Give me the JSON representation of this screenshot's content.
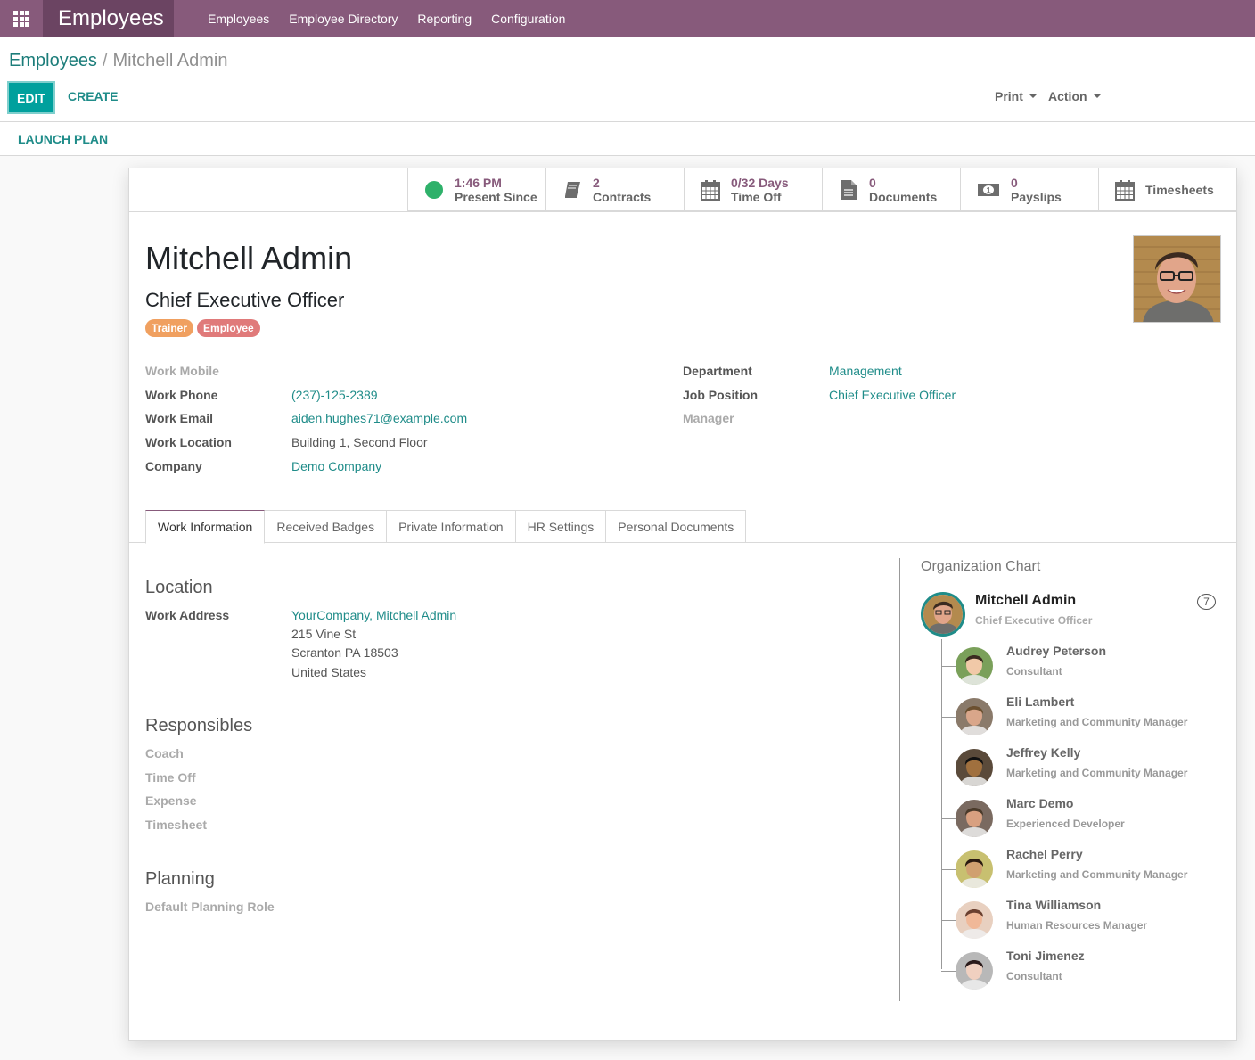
{
  "navbar": {
    "app_name": "Employees",
    "menu": [
      "Employees",
      "Employee Directory",
      "Reporting",
      "Configuration"
    ],
    "color": "#875a7b"
  },
  "breadcrumb": {
    "parent": "Employees",
    "separator": "/",
    "current": "Mitchell Admin"
  },
  "toolbar": {
    "edit_label": "EDIT",
    "create_label": "CREATE",
    "print_label": "Print",
    "action_label": "Action"
  },
  "statusbar": {
    "launch_plan_label": "LAUNCH PLAN"
  },
  "smart_buttons": [
    {
      "icon": "presence-dot-icon",
      "value": "1:46 PM",
      "label": "Present Since"
    },
    {
      "icon": "book-icon",
      "value": "2",
      "label": "Contracts"
    },
    {
      "icon": "calendar-icon",
      "value": "0/32 Days",
      "label": "Time Off"
    },
    {
      "icon": "document-icon",
      "value": "0",
      "label": "Documents"
    },
    {
      "icon": "money-icon",
      "value": "0",
      "label": "Payslips"
    },
    {
      "icon": "calendar-icon",
      "value": "",
      "label": "Timesheets"
    }
  ],
  "employee": {
    "name": "Mitchell Admin",
    "job_title": "Chief Executive Officer",
    "tags": [
      {
        "label": "Trainer",
        "color": "#f0a060"
      },
      {
        "label": "Employee",
        "color": "#e07a7a"
      }
    ]
  },
  "fields_left": [
    {
      "label": "Work Mobile",
      "value": "",
      "empty": true
    },
    {
      "label": "Work Phone",
      "value": "(237)-125-2389",
      "link": true
    },
    {
      "label": "Work Email",
      "value": "aiden.hughes71@example.com",
      "link": true
    },
    {
      "label": "Work Location",
      "value": "Building 1, Second Floor",
      "link": false
    },
    {
      "label": "Company",
      "value": "Demo Company",
      "link": true
    }
  ],
  "fields_right": [
    {
      "label": "Department",
      "value": "Management",
      "link": true
    },
    {
      "label": "Job Position",
      "value": "Chief Executive Officer",
      "link": true
    },
    {
      "label": "Manager",
      "value": "",
      "empty": true
    }
  ],
  "tabs": [
    "Work Information",
    "Received Badges",
    "Private Information",
    "HR Settings",
    "Personal Documents"
  ],
  "active_tab": "Work Information",
  "work_info": {
    "location_title": "Location",
    "work_address_label": "Work Address",
    "work_address_name": "YourCompany, Mitchell Admin",
    "address_lines": [
      "215 Vine St",
      "Scranton PA 18503",
      "United States"
    ],
    "responsibles_title": "Responsibles",
    "responsibles": [
      "Coach",
      "Time Off",
      "Expense",
      "Timesheet"
    ],
    "planning_title": "Planning",
    "planning_fields": [
      "Default Planning Role"
    ]
  },
  "org_chart": {
    "title": "Organization Chart",
    "main": {
      "name": "Mitchell Admin",
      "job": "Chief Executive Officer",
      "count": "7"
    },
    "subordinates": [
      {
        "name": "Audrey Peterson",
        "job": "Consultant"
      },
      {
        "name": "Eli Lambert",
        "job": "Marketing and Community Manager"
      },
      {
        "name": "Jeffrey Kelly",
        "job": "Marketing and Community Manager"
      },
      {
        "name": "Marc Demo",
        "job": "Experienced Developer"
      },
      {
        "name": "Rachel Perry",
        "job": "Marketing and Community Manager"
      },
      {
        "name": "Tina Williamson",
        "job": "Human Resources Manager"
      },
      {
        "name": "Toni Jimenez",
        "job": "Consultant"
      }
    ]
  }
}
